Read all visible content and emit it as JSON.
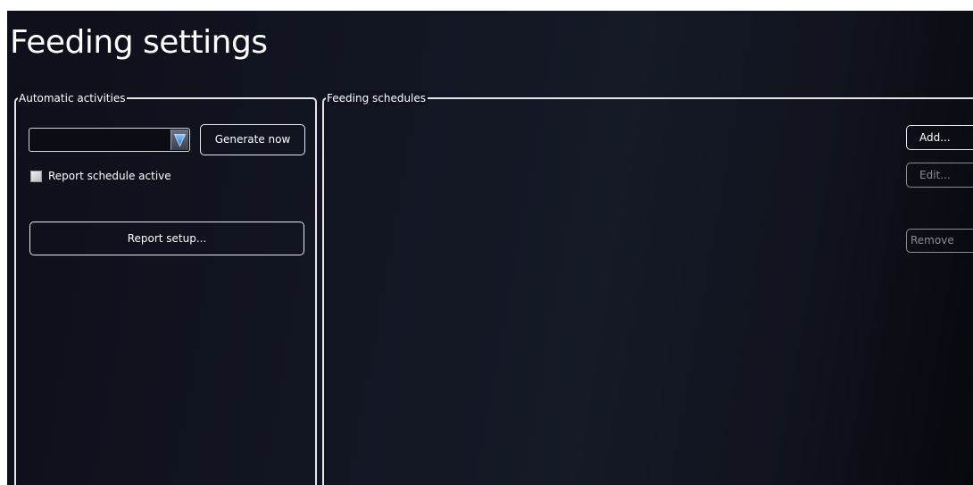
{
  "page": {
    "title": "Feeding settings"
  },
  "automatic_activities": {
    "legend": "Automatic activities",
    "report_type_select": {
      "value": "",
      "arrow_icon": "triangle-down-icon"
    },
    "generate_now_label": "Generate now",
    "report_schedule_active": {
      "label": "Report schedule active",
      "checked": false
    },
    "report_setup_label": "Report setup..."
  },
  "feeding_schedules": {
    "legend": "Feeding schedules",
    "add_label": "Add...",
    "edit_label": "Edit...",
    "remove_label": "Remove",
    "edit_enabled": false,
    "remove_enabled": false
  },
  "colors": {
    "background_dark": "#10131e",
    "border": "#e6e6e6",
    "text": "#ffffff",
    "disabled_text": "#8c8c8c",
    "combo_arrow_blue": "#3d8fd8"
  }
}
